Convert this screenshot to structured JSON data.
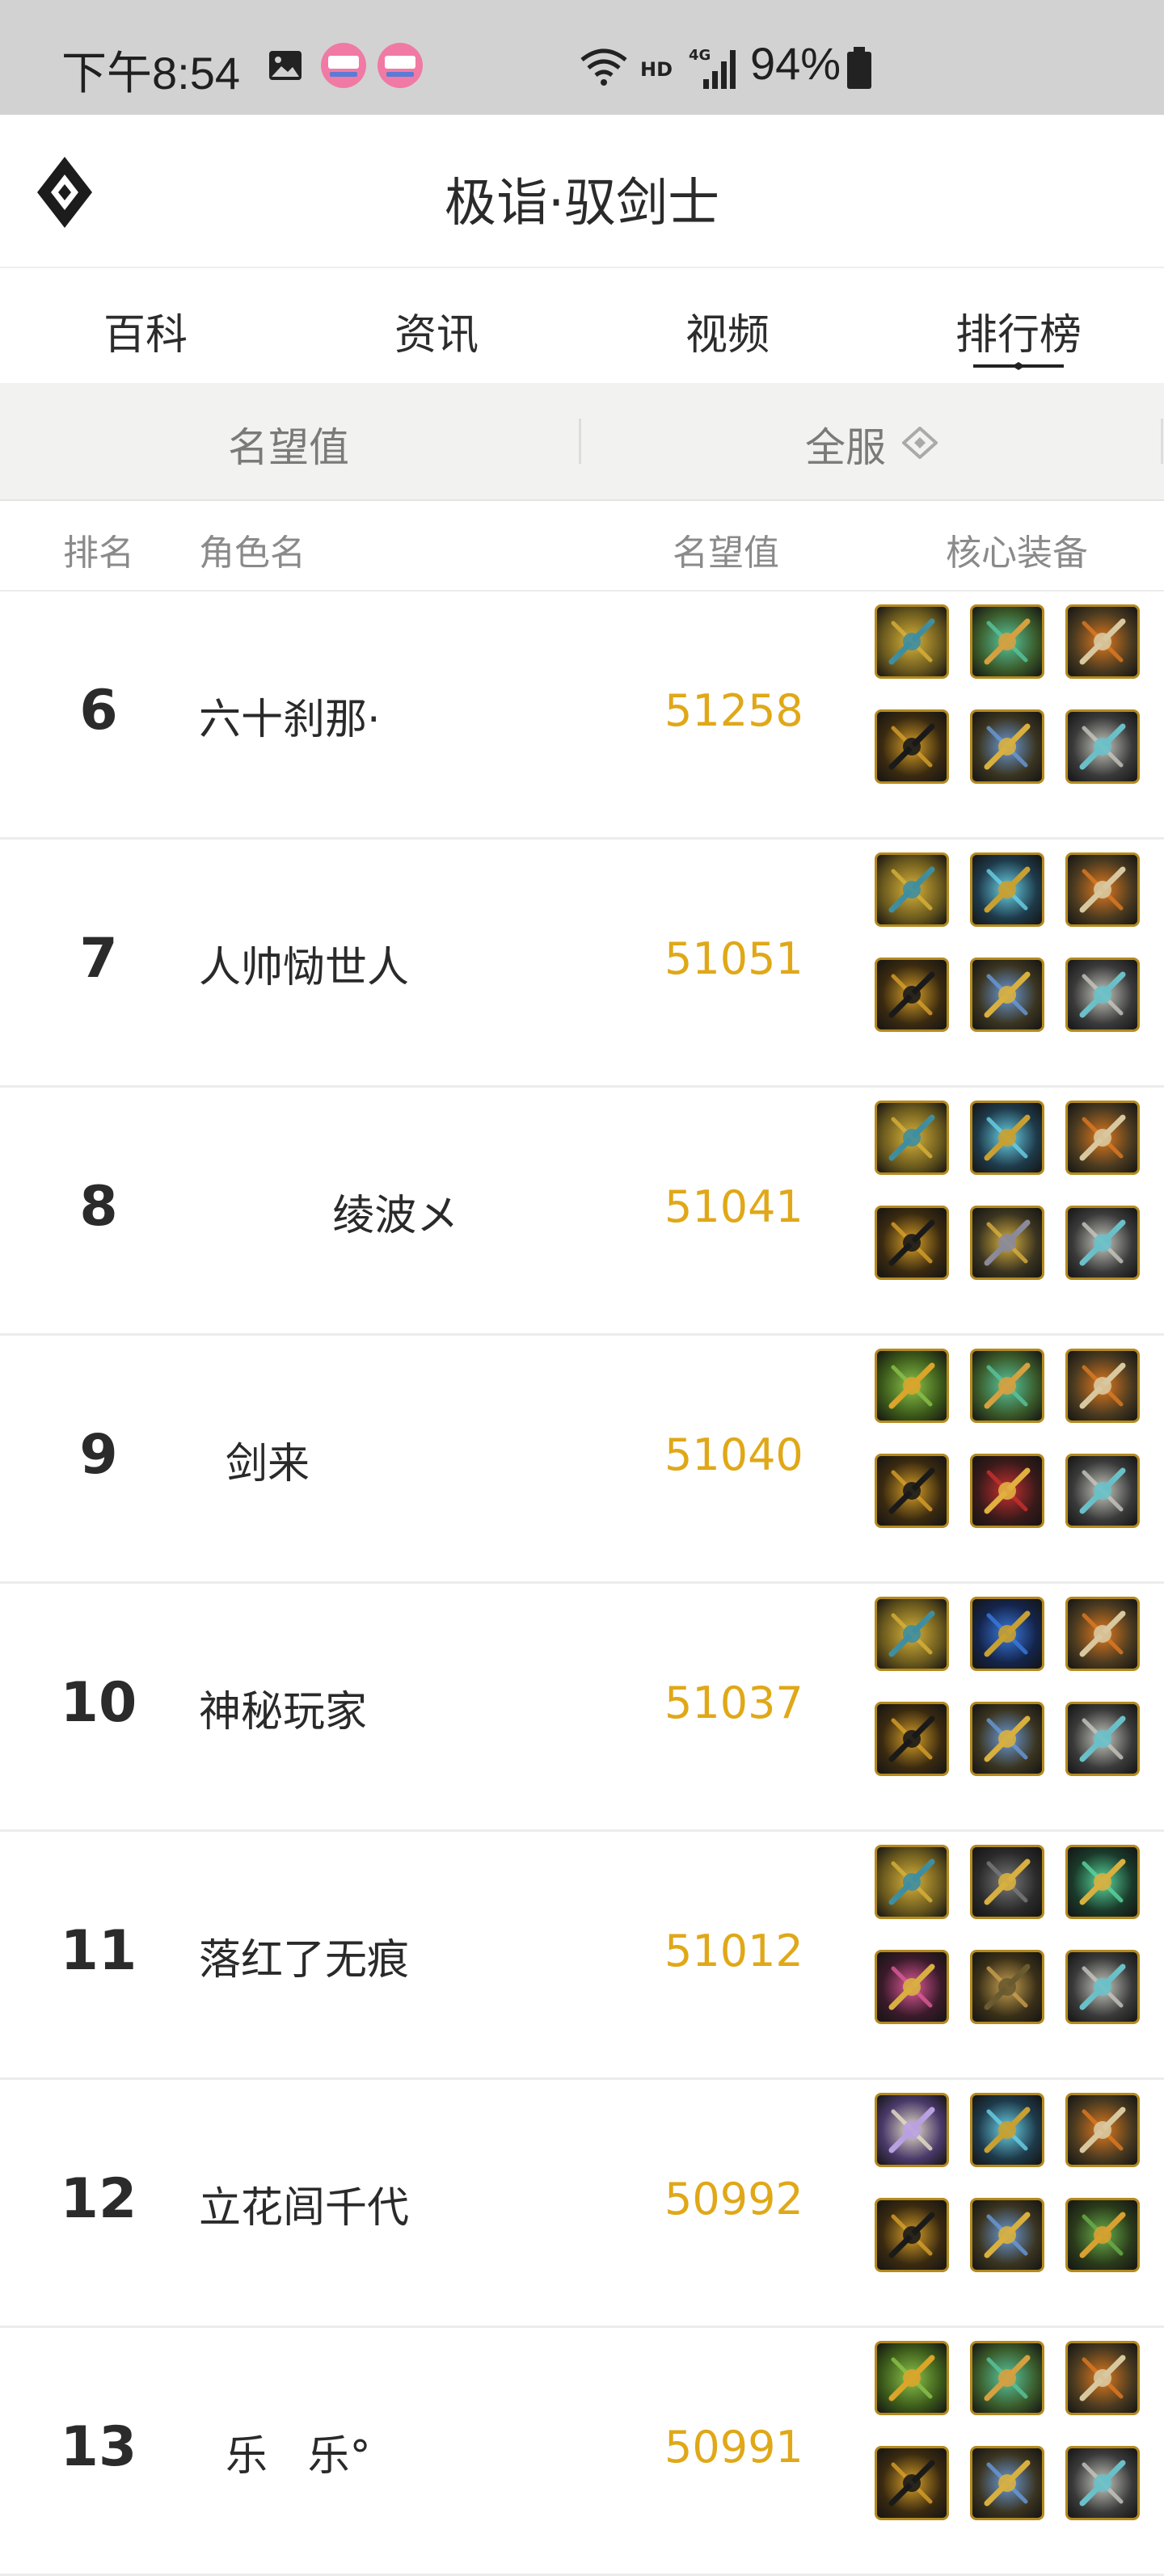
{
  "status_bar": {
    "time": "下午8:54",
    "battery": "94%",
    "icons": [
      "image-icon",
      "bilibili-icon",
      "bilibili-icon",
      "wifi-icon",
      "hd-icon",
      "4g-signal-icon",
      "battery-icon"
    ]
  },
  "header": {
    "title": "极诣·驭剑士",
    "logo_icon": "diamond-logo-icon"
  },
  "tabs": [
    {
      "label": "百科"
    },
    {
      "label": "资讯"
    },
    {
      "label": "视频"
    },
    {
      "label": "排行榜",
      "active": true
    }
  ],
  "filters": {
    "metric": "名望值",
    "server": "全服"
  },
  "columns": {
    "rank": "排名",
    "name": "角色名",
    "score": "名望值",
    "equip": "核心装备"
  },
  "colors": {
    "score": "#e0a818",
    "accent": "#2b2b2b"
  },
  "rows": [
    {
      "rank": "6",
      "name": "六十刹那·",
      "score": "51258",
      "equip": [
        "weapon-a",
        "green-orb",
        "atom",
        "belt-gold",
        "cross-blue",
        "stone-armor"
      ]
    },
    {
      "rank": "7",
      "name": "人帅恸世人",
      "score": "51051",
      "equip": [
        "weapon-a",
        "blue-orb",
        "atom",
        "belt-gold",
        "cross-blue",
        "stone-armor"
      ]
    },
    {
      "rank": "8",
      "name": "          绫波メ",
      "score": "51041",
      "equip": [
        "weapon-a",
        "blue-orb",
        "atom",
        "belt-gold",
        "cross-gold",
        "stone-armor"
      ]
    },
    {
      "rank": "9",
      "name": "  剑来",
      "score": "51040",
      "equip": [
        "weapon-green",
        "green-orb",
        "atom",
        "belt-gold",
        "red-armor",
        "stone-armor"
      ]
    },
    {
      "rank": "10",
      "name": "神秘玩家",
      "score": "51037",
      "equip": [
        "weapon-a",
        "ring-blue",
        "atom",
        "belt-gold",
        "cross-blue",
        "stone-armor"
      ]
    },
    {
      "rank": "11",
      "name": "落红了无痕",
      "score": "51012",
      "equip": [
        "weapon-a",
        "claw-dark",
        "green-ring",
        "ring-pink",
        "cape-gold",
        "stone-armor"
      ]
    },
    {
      "rank": "12",
      "name": "立花闾千代",
      "score": "50992",
      "equip": [
        "weapon-purple",
        "blue-orb",
        "atom",
        "belt-gold",
        "cross-blue",
        "green-coat"
      ]
    },
    {
      "rank": "13",
      "name": "  乐   乐°",
      "score": "50991",
      "equip": [
        "weapon-green",
        "green-orb",
        "atom",
        "belt-gold",
        "cross-blue",
        "stone-armor"
      ]
    }
  ]
}
